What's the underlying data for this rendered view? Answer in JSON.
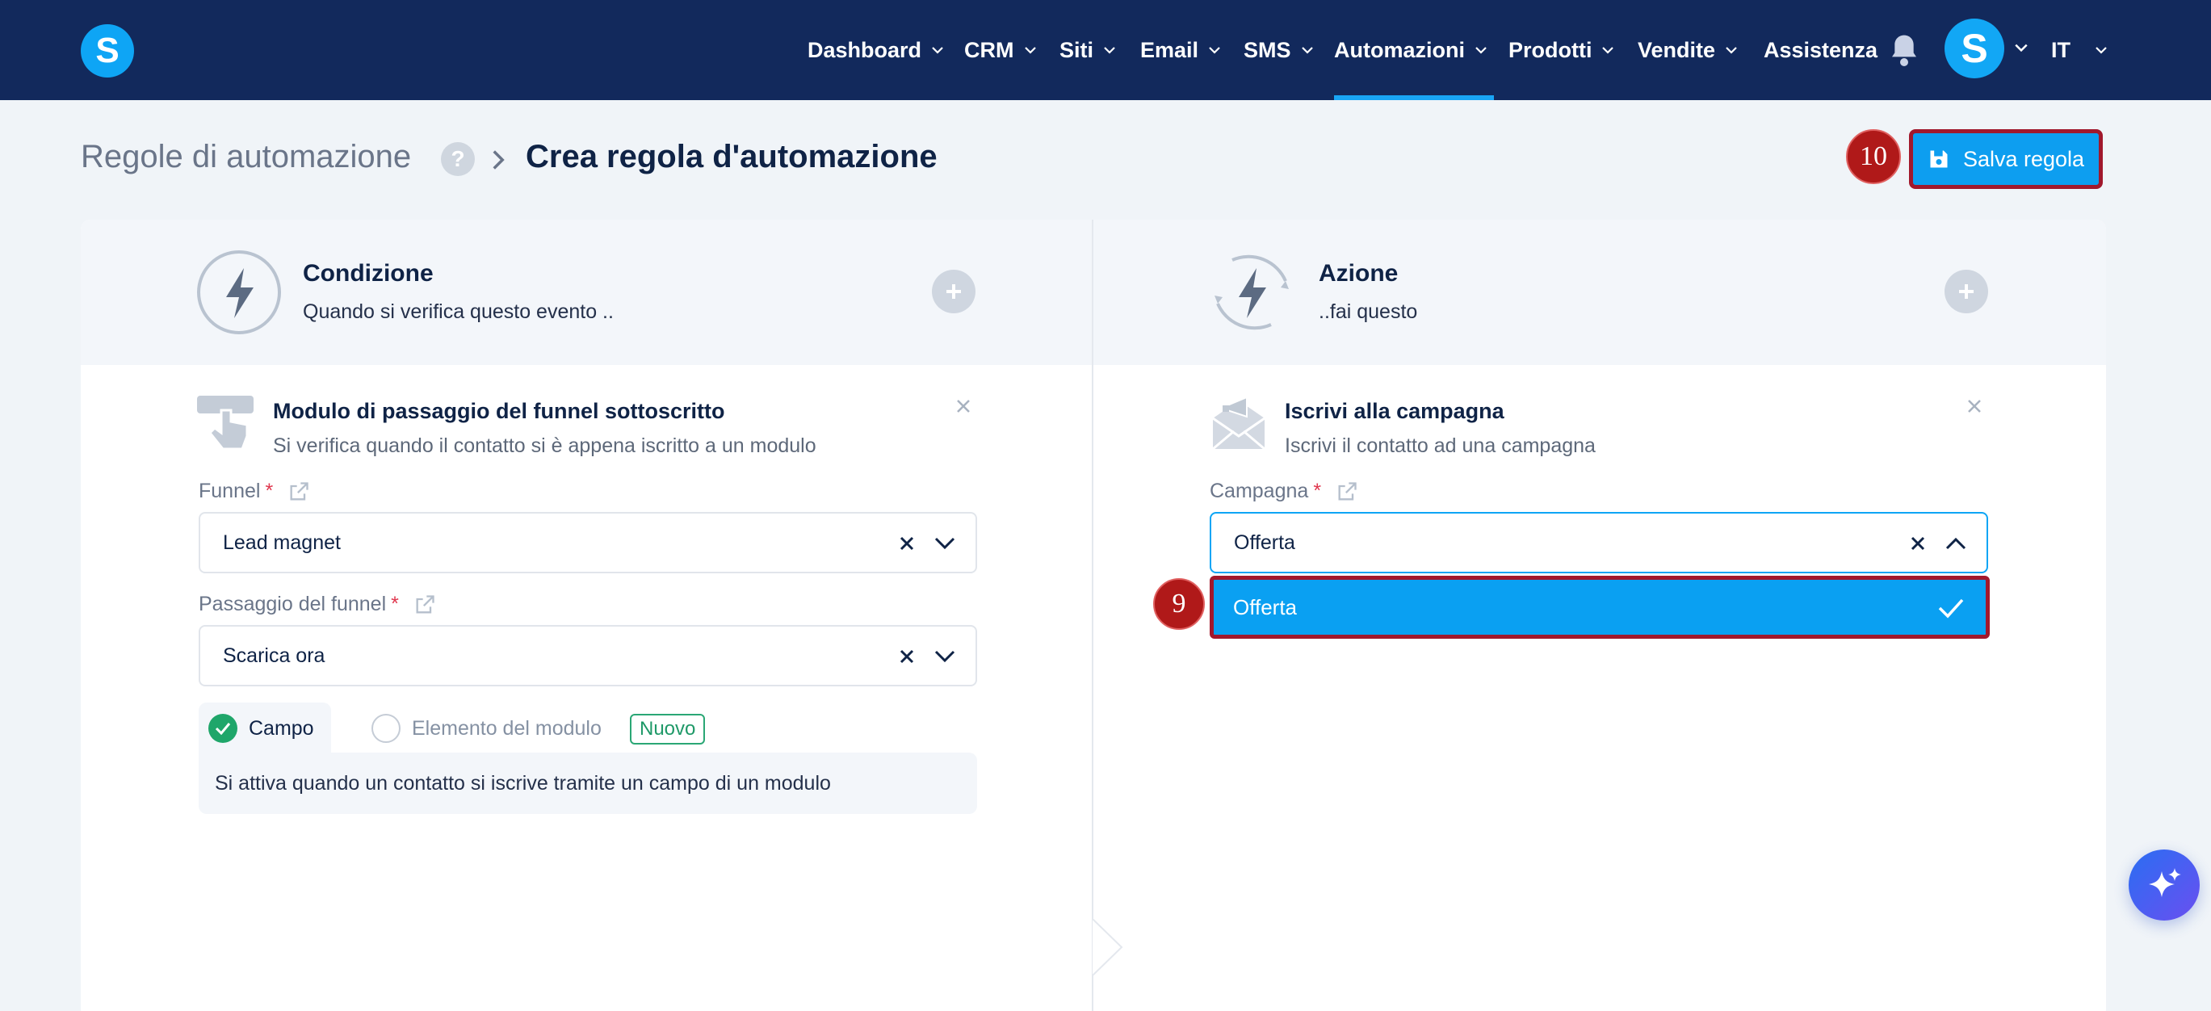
{
  "nav": {
    "logo": "S",
    "items": [
      {
        "label": "Dashboard",
        "has_menu": true
      },
      {
        "label": "CRM",
        "has_menu": true
      },
      {
        "label": "Siti",
        "has_menu": true
      },
      {
        "label": "Email",
        "has_menu": true
      },
      {
        "label": "SMS",
        "has_menu": true
      },
      {
        "label": "Automazioni",
        "has_menu": true,
        "active": true
      },
      {
        "label": "Prodotti",
        "has_menu": true
      },
      {
        "label": "Vendite",
        "has_menu": true
      },
      {
        "label": "Assistenza",
        "has_menu": false
      }
    ],
    "avatar_initial": "S",
    "language": "IT",
    "notifications_icon": "bell-icon"
  },
  "header": {
    "breadcrumb_root": "Regole di automazione",
    "help": "?",
    "breadcrumb_current": "Crea regola d'automazione",
    "save_label": "Salva regola"
  },
  "annotations": {
    "save_step": "10",
    "option_step": "9"
  },
  "condition": {
    "title": "Condizione",
    "subtitle": "Quando si verifica questo evento ..",
    "block_title": "Modulo di passaggio del funnel sottoscritto",
    "block_subtitle": "Si verifica quando il contatto si è appena iscritto a un modulo",
    "funnel_label": "Funnel",
    "funnel_value": "Lead magnet",
    "step_label": "Passaggio del funnel",
    "step_value": "Scarica ora",
    "radio_field": "Campo",
    "radio_element": "Elemento del modulo",
    "new_badge": "Nuovo",
    "info": "Si attiva quando un contatto si iscrive tramite un campo di un modulo"
  },
  "action": {
    "title": "Azione",
    "subtitle": "..fai questo",
    "block_title": "Iscrivi alla campagna",
    "block_subtitle": "Iscrivi il contatto ad una campagna",
    "campaign_label": "Campagna",
    "campaign_value": "Offerta",
    "options": [
      "Offerta"
    ]
  },
  "colors": {
    "nav_bg": "#12295c",
    "accent": "#0ea5f5",
    "annotation": "#b01919",
    "success": "#1fa66a"
  }
}
